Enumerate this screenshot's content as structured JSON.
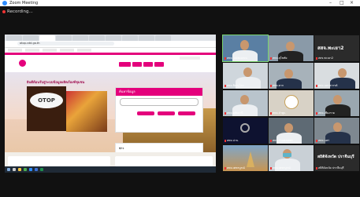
{
  "window": {
    "title": "Zoom Meeting",
    "controls": [
      "–",
      "□",
      "×"
    ]
  },
  "recording": {
    "label": "Recording..."
  },
  "shared_screen": {
    "browser": {
      "tabs_count": 10,
      "url": "otop.cdd.go.th"
    },
    "site": {
      "welcome": "ยินดีต้อนรับสู่ระบบข้อมูลผลิตภัณฑ์ชุมชน",
      "otop_logo": "OTOP",
      "search_title": "ค้นหาข้อมูล",
      "news_title": "ข่าว"
    }
  },
  "participants": [
    {
      "id": "p1",
      "name": "สสจ.พะเยา2",
      "muted": true,
      "style": "name-only"
    },
    {
      "id": "p2",
      "name": "สพจ. แม่ฮ่องสอน",
      "muted": true,
      "style": "person"
    },
    {
      "id": "p3",
      "name": "สพจ.สุโขทัย",
      "muted": true,
      "style": "person"
    },
    {
      "id": "p4",
      "name": "สพจ.พิษณุโลก",
      "muted": true,
      "style": "person"
    },
    {
      "id": "p5",
      "name": "สพจ.ตาก",
      "muted": true,
      "style": "person"
    },
    {
      "id": "p6",
      "name": "สพจ.นครสวรรค์",
      "muted": true,
      "style": "person"
    },
    {
      "id": "p7",
      "name": "สพจ.อุทัยธานี",
      "muted": true,
      "style": "person"
    },
    {
      "id": "p8",
      "name": "สพจ.ลำพูน",
      "muted": true,
      "style": "logo"
    },
    {
      "id": "p9",
      "name": "สพจ.เชียงราย",
      "muted": true,
      "style": "dark"
    },
    {
      "id": "p10",
      "name": "สพจ.น่าน",
      "muted": true,
      "style": "person"
    },
    {
      "id": "p11",
      "name": "สพจ.กำแพงเพชร",
      "muted": true,
      "style": "person"
    },
    {
      "id": "p12",
      "name": "สพจ.แพร่",
      "muted": true,
      "style": "person"
    },
    {
      "id": "p13",
      "name": "สพจ.เพชรบูรณ์",
      "muted": true,
      "style": "person"
    },
    {
      "id": "p14",
      "name": "สถิติจังหวัด ปราจีนบุรี",
      "muted": true,
      "style": "name-only"
    }
  ],
  "colors": {
    "accent": "#e4007c",
    "active_speaker": "#7bd46f",
    "zoom_blue": "#2d8cff"
  }
}
